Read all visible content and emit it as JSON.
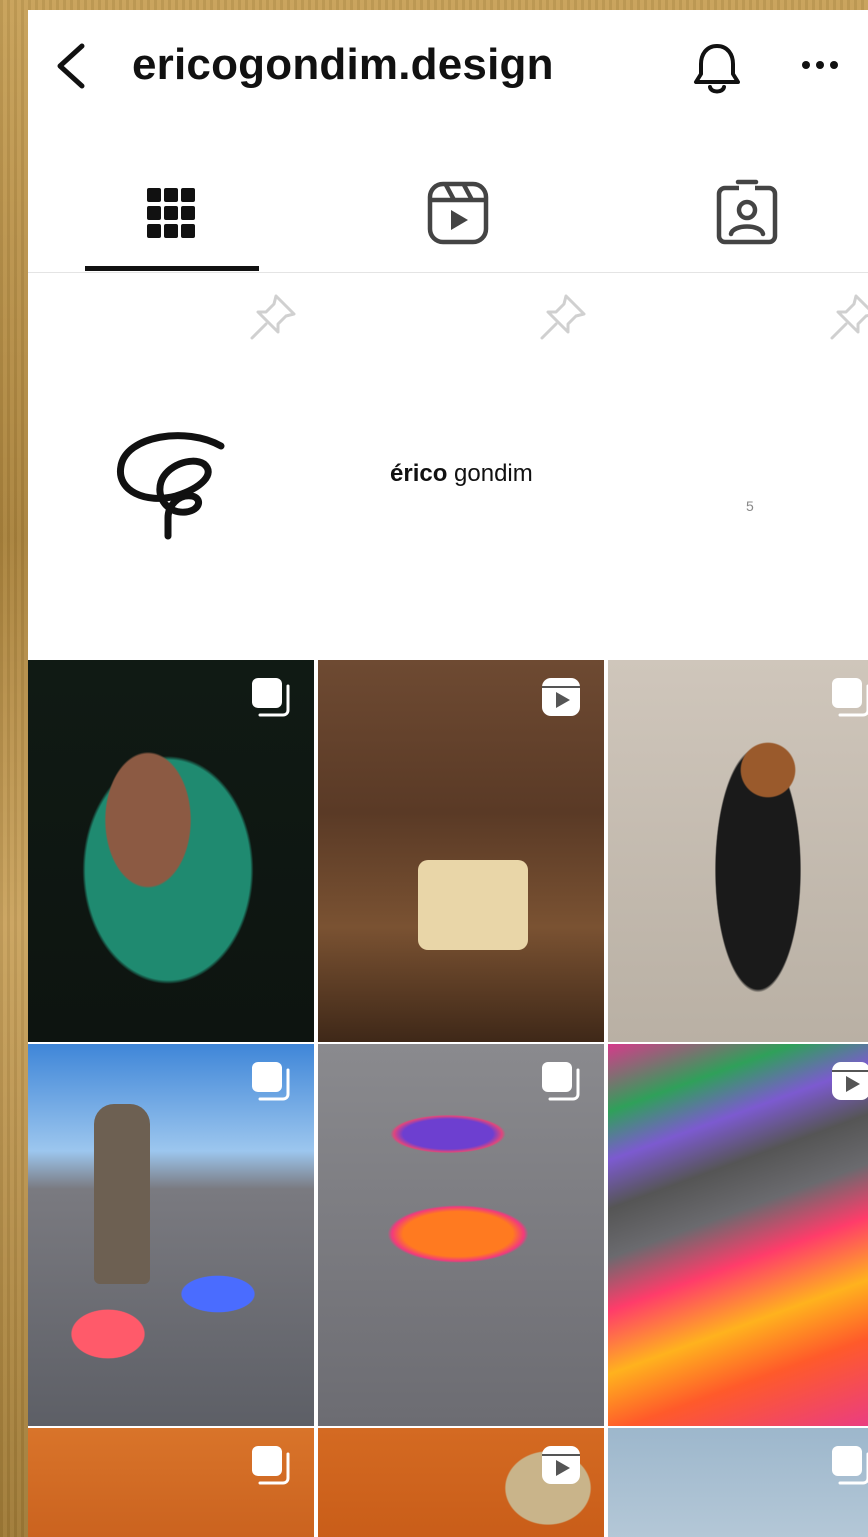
{
  "header": {
    "username": "ericogondim.design",
    "back_icon": "chevron-left-icon",
    "bell_icon": "bell-icon",
    "more_icon": "more-horizontal-icon"
  },
  "tabs": [
    {
      "name": "posts-grid",
      "icon": "grid-icon",
      "active": true
    },
    {
      "name": "reels",
      "icon": "reels-icon",
      "active": false
    },
    {
      "name": "tagged",
      "icon": "tagged-person-icon",
      "active": false
    }
  ],
  "pinned": [
    {
      "icon": "pin-icon",
      "content": "logo-mark"
    },
    {
      "icon": "pin-icon",
      "wordmark_bold": "érico",
      "wordmark_light": " gondim"
    },
    {
      "icon": "pin-icon",
      "small_text": "5"
    }
  ],
  "posts": [
    {
      "type": "carousel",
      "badge_icon": "carousel-icon",
      "subject": "woman-with-green-sculpture"
    },
    {
      "type": "reel",
      "badge_icon": "reel-icon",
      "subject": "lounge-chair-interior"
    },
    {
      "type": "carousel",
      "badge_icon": "carousel-icon",
      "subject": "black-wall-sculpture"
    },
    {
      "type": "carousel",
      "badge_icon": "carousel-icon",
      "subject": "man-with-colorful-tables"
    },
    {
      "type": "carousel",
      "badge_icon": "carousel-icon",
      "subject": "colorful-wavy-table"
    },
    {
      "type": "reel",
      "badge_icon": "reel-icon",
      "subject": "colorful-wavy-bench"
    },
    {
      "type": "carousel",
      "badge_icon": "carousel-icon",
      "subject": "orange-wall-pieces"
    },
    {
      "type": "reel",
      "badge_icon": "reel-icon",
      "subject": "orange-wall-piece-closeup"
    },
    {
      "type": "carousel",
      "badge_icon": "carousel-icon",
      "subject": "sky-view"
    }
  ],
  "colors": {
    "active": "#111111",
    "divider": "#e4e4e4",
    "pin": "#d0d0d0"
  }
}
